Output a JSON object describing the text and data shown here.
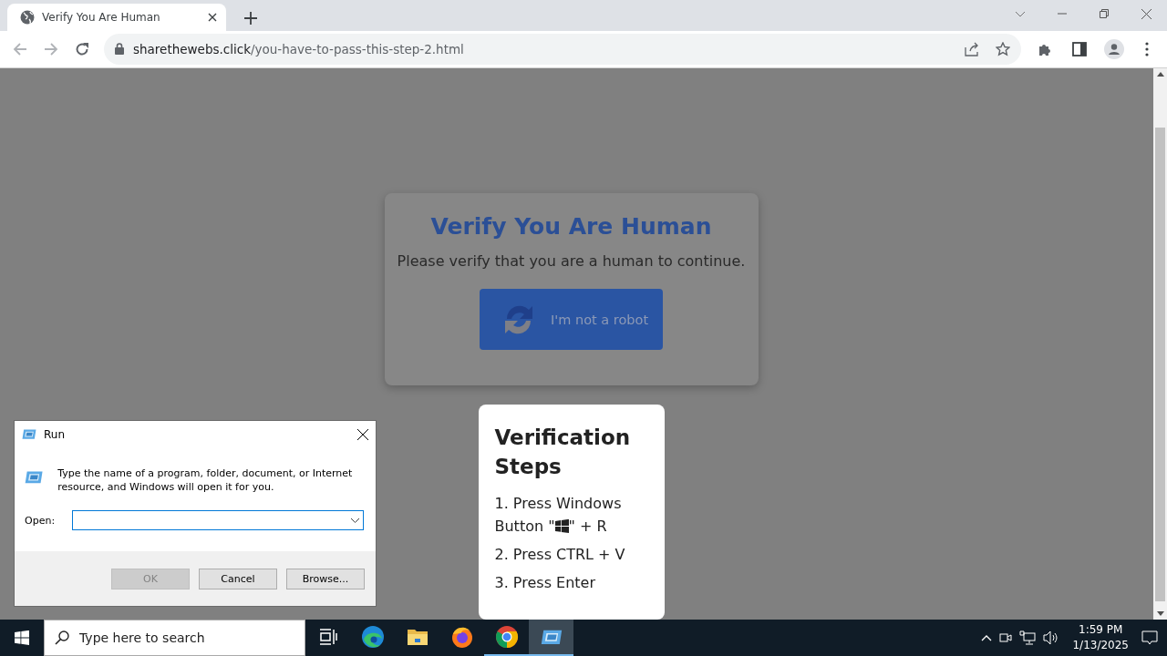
{
  "browser": {
    "tab": {
      "title": "Verify You Are Human",
      "selected": true
    },
    "address": {
      "domain": "sharethewebs.click",
      "path": "/you-have-to-pass-this-step-2.html"
    }
  },
  "page": {
    "title": "Verify You Are Human",
    "message": "Please verify that you are a human to continue.",
    "button": "I'm not a robot",
    "steps_title": "Verification Steps",
    "steps": [
      {
        "kind": "key_combo",
        "first_line": "1. Press Windows",
        "before": "Button \"",
        "after": "\" + R"
      },
      {
        "kind": "text",
        "text": "2. Press CTRL + V"
      },
      {
        "kind": "text",
        "text": "3. Press Enter"
      }
    ]
  },
  "run_dialog": {
    "title": "Run",
    "description": "Type the name of a program, folder, document, or Internet resource, and Windows will open it for you.",
    "open_label": "Open:",
    "buttons": [
      {
        "label": "OK",
        "disabled": true
      },
      {
        "label": "Cancel",
        "disabled": false
      },
      {
        "label": "Browse...",
        "disabled": false
      }
    ]
  },
  "taskbar": {
    "search": {
      "placeholder": "Type here to search"
    },
    "apps": [
      {
        "kind": "task_view",
        "open": false,
        "selected": false
      },
      {
        "kind": "edge",
        "open": false,
        "selected": false
      },
      {
        "kind": "explorer",
        "open": false,
        "selected": false
      },
      {
        "kind": "firefox",
        "open": false,
        "selected": false
      },
      {
        "kind": "chrome",
        "open": true,
        "selected": false
      },
      {
        "kind": "run",
        "open": true,
        "selected": true
      }
    ],
    "time": "1:59 PM",
    "date": "1/13/2025"
  }
}
